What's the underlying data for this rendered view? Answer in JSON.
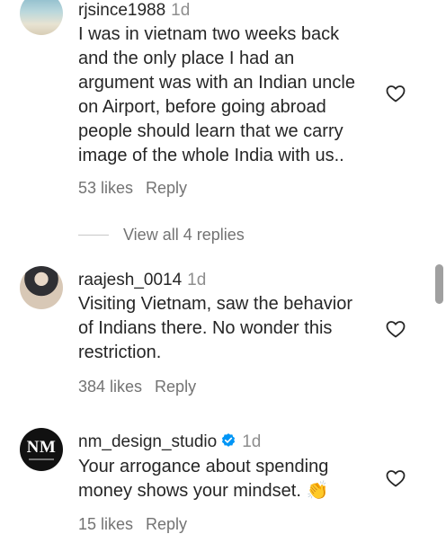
{
  "comments": [
    {
      "username": "rjsince1988",
      "age": "1d",
      "text_lines": [
        "I was in vietnam two weeks back",
        "and the only place I had an",
        "argument was with an Indian uncle",
        "on Airport, before going abroad",
        "people should learn that we carry",
        "image of the whole India with us.."
      ],
      "likes": "53 likes",
      "reply_label": "Reply",
      "avatar_icon": "sea-photo-avatar"
    },
    {
      "username": "raajesh_0014",
      "age": "1d",
      "text_lines": [
        "Visiting Vietnam, saw the behavior",
        "of Indians there. No wonder this",
        "restriction."
      ],
      "likes": "384 likes",
      "reply_label": "Reply",
      "avatar_icon": "person-photo-avatar"
    },
    {
      "username": "nm_design_studio",
      "age": "1d",
      "text_lines": [
        "Your arrogance about spending",
        "money shows your mindset. 👏"
      ],
      "likes": "15 likes",
      "reply_label": "Reply",
      "avatar_text": "NM",
      "verified_icon": "verified-badge-icon",
      "avatar_icon": "nm-logo-avatar"
    }
  ],
  "view_replies": "View all 4 replies",
  "icons": {
    "like": "heart-outline-icon"
  },
  "colors": {
    "text": "#262626",
    "muted": "#737373",
    "verified": "#0095f6"
  }
}
